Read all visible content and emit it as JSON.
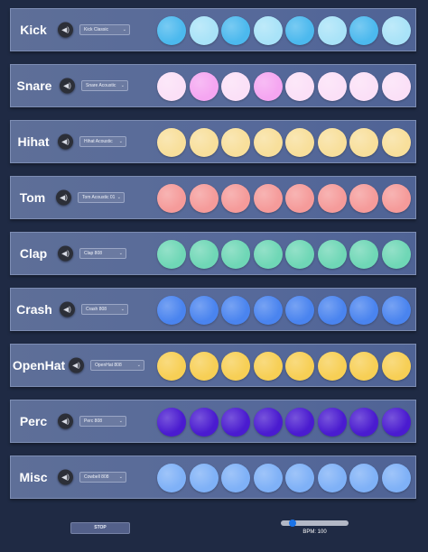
{
  "tracks": [
    {
      "name": "Kick",
      "sample": "Kick Classic",
      "pads": [
        "#4cb9ee",
        "#a9e3f8",
        "#4cb9ee",
        "#a9e3f8",
        "#4cb9ee",
        "#a9e3f8",
        "#4cb9ee",
        "#a9e3f8"
      ]
    },
    {
      "name": "Snare",
      "sample": "Snare Acoustic",
      "pads": [
        "#fbe0f7",
        "#f5a6f1",
        "#fbe0f7",
        "#f5a6f1",
        "#fbe0f7",
        "#fbe0f7",
        "#fbe0f7",
        "#fbe0f7"
      ]
    },
    {
      "name": "Hihat",
      "sample": "Hihat Acoustic",
      "pads": [
        "#f8df9b",
        "#f8df9b",
        "#f8df9b",
        "#f8df9b",
        "#f8df9b",
        "#f8df9b",
        "#f8df9b",
        "#f8df9b"
      ]
    },
    {
      "name": "Tom",
      "sample": "Tom Acoustic 01",
      "pads": [
        "#f59b9a",
        "#f59b9a",
        "#f59b9a",
        "#f59b9a",
        "#f59b9a",
        "#f59b9a",
        "#f59b9a",
        "#f59b9a"
      ]
    },
    {
      "name": "Clap",
      "sample": "Clap 808",
      "pads": [
        "#6fd7b6",
        "#6fd7b6",
        "#6fd7b6",
        "#6fd7b6",
        "#6fd7b6",
        "#6fd7b6",
        "#6fd7b6",
        "#6fd7b6"
      ]
    },
    {
      "name": "Crash",
      "sample": "Crash 808",
      "pads": [
        "#4a84ef",
        "#4a84ef",
        "#4a84ef",
        "#4a84ef",
        "#4a84ef",
        "#4a84ef",
        "#4a84ef",
        "#4a84ef"
      ]
    },
    {
      "name": "OpenHat",
      "sample": "OpenHat 808",
      "pads": [
        "#f7cf55",
        "#f7cf55",
        "#f7cf55",
        "#f7cf55",
        "#f7cf55",
        "#f7cf55",
        "#f7cf55",
        "#f7cf55"
      ]
    },
    {
      "name": "Perc",
      "sample": "Perc 808",
      "pads": [
        "#4a1bd0",
        "#4a1bd0",
        "#4a1bd0",
        "#4a1bd0",
        "#4a1bd0",
        "#4a1bd0",
        "#4a1bd0",
        "#4a1bd0"
      ]
    },
    {
      "name": "Misc",
      "sample": "Cowbell 808",
      "pads": [
        "#7fb1f7",
        "#7fb1f7",
        "#7fb1f7",
        "#7fb1f7",
        "#7fb1f7",
        "#7fb1f7",
        "#7fb1f7",
        "#7fb1f7"
      ]
    }
  ],
  "controls": {
    "stop_label": "STOP",
    "bpm_label": "BPM: 100",
    "bpm_value": 100
  },
  "icons": {
    "mute": "speaker-icon"
  }
}
